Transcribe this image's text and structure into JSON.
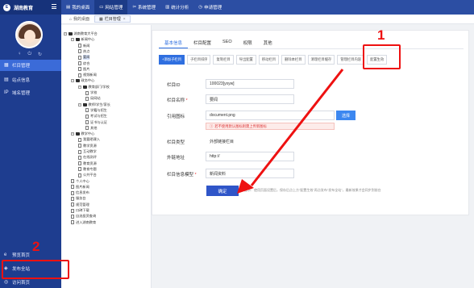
{
  "sidebar": {
    "logo_text": "湖南教育",
    "logo_mark": "E",
    "user_icons": [
      "♀",
      "⏻",
      "↻"
    ],
    "items": [
      {
        "label": "栏目管理",
        "icon": "▦",
        "active": true
      },
      {
        "label": "站点信息",
        "icon": "▤",
        "active": false
      },
      {
        "label": "域名管理",
        "icon": "IP",
        "active": false
      },
      {
        "label": "预览首页",
        "icon": "e",
        "active": false
      },
      {
        "label": "发布全站",
        "icon": "◈",
        "active": false
      },
      {
        "label": "访问首页",
        "icon": "◎",
        "active": false
      }
    ]
  },
  "topnav": [
    {
      "label": "我的桌面",
      "icon": "▤",
      "active": false
    },
    {
      "label": "网站管理",
      "icon": "▭",
      "active": true
    },
    {
      "label": "系统管理",
      "icon": "✂",
      "active": false
    },
    {
      "label": "统计分析",
      "icon": "▥",
      "active": false
    },
    {
      "label": "申请管理",
      "icon": "◷",
      "active": false
    }
  ],
  "page_tabs": [
    {
      "label": "我的桌面",
      "icon": "⌂"
    },
    {
      "label": "栏目管理",
      "icon": "▦",
      "closable": "×"
    }
  ],
  "tree": [
    {
      "label": "湖南教育大平台",
      "type": "folder",
      "lvl": 0,
      "toggle": "−"
    },
    {
      "label": "新闻中心",
      "type": "folder",
      "lvl": 1,
      "toggle": "−"
    },
    {
      "label": "新闻",
      "type": "doc",
      "lvl": 2
    },
    {
      "label": "热点",
      "type": "doc",
      "lvl": 2
    },
    {
      "label": "要闻",
      "type": "doc",
      "lvl": 2,
      "selected": true
    },
    {
      "label": "综合",
      "type": "doc",
      "lvl": 2
    },
    {
      "label": "图片",
      "type": "doc",
      "lvl": 2
    },
    {
      "label": "视频新闻",
      "type": "doc",
      "lvl": 2
    },
    {
      "label": "政务中心",
      "type": "folder",
      "lvl": 1,
      "toggle": "−"
    },
    {
      "label": "教育部门/学校",
      "type": "folder",
      "lvl": 2,
      "toggle": "−"
    },
    {
      "label": "学校",
      "type": "doc",
      "lvl": 3
    },
    {
      "label": "局网站",
      "type": "doc",
      "lvl": 3
    },
    {
      "label": "教师/学生/家长",
      "type": "folder",
      "lvl": 2,
      "toggle": "−"
    },
    {
      "label": "学籍与招生",
      "type": "doc",
      "lvl": 3
    },
    {
      "label": "考试与招生",
      "type": "doc",
      "lvl": 3
    },
    {
      "label": "证书与认证",
      "type": "doc",
      "lvl": 3
    },
    {
      "label": "其他",
      "type": "doc",
      "lvl": 3
    },
    {
      "label": "教学中心",
      "type": "folder",
      "lvl": 1,
      "toggle": "−"
    },
    {
      "label": "我要晒课入",
      "type": "doc",
      "lvl": 2
    },
    {
      "label": "教学资源",
      "type": "doc",
      "lvl": 2
    },
    {
      "label": "互动教学",
      "type": "doc",
      "lvl": 2
    },
    {
      "label": "在线测评",
      "type": "doc",
      "lvl": 2
    },
    {
      "label": "教育资源",
      "type": "doc",
      "lvl": 2
    },
    {
      "label": "教育专题",
      "type": "doc",
      "lvl": 2
    },
    {
      "label": "公共平台",
      "type": "doc",
      "lvl": 2
    },
    {
      "label": "个人中心",
      "type": "doc",
      "lvl": 1
    },
    {
      "label": "图片新闻",
      "type": "doc",
      "lvl": 1
    },
    {
      "label": "信息发布",
      "type": "doc",
      "lvl": 1
    },
    {
      "label": "服务台",
      "type": "doc",
      "lvl": 1
    },
    {
      "label": "规范管理",
      "type": "doc",
      "lvl": 1
    },
    {
      "label": "口碑下载",
      "type": "doc",
      "lvl": 1
    },
    {
      "label": "自选投资查询",
      "type": "doc",
      "lvl": 1
    },
    {
      "label": "进入湖南教育",
      "type": "doc",
      "lvl": 1
    }
  ],
  "main": {
    "tabs": [
      "基本信息",
      "栏目配置",
      "SEO",
      "权限",
      "其他"
    ],
    "active_tab": 0,
    "subtabs": [
      "+添加子栏目",
      "子栏目排序",
      "复制栏目",
      "导出配置",
      "移动栏目",
      "删除本栏目",
      "清理栏目缓存",
      "管理栏目内容",
      "配置生效"
    ],
    "fields": {
      "id_label": "栏目ID",
      "id_value": "100023[yxyw]",
      "name_label": "栏目名称",
      "name_required": "*",
      "name_value": "要闻",
      "icon_label": "引用图标",
      "icon_value": "document.png",
      "choose_label": "选择",
      "warn_text": "若不使用默认图标则需上传新图标",
      "type_label": "栏目类型",
      "type_value": "外部链接栏目",
      "url_label": "外链地址",
      "url_value": "http://",
      "tpl_label": "栏目信息模型",
      "tpl_required": "*",
      "tpl_value": "新闻资料"
    },
    "confirm_label": "确定",
    "hint_text": "提示：使用页面设置后，保存后点上方\"配置生效\"再点发布\"发布全站\"，最新效果才会同步到前台"
  },
  "annotations": {
    "num1": "1",
    "num2": "2",
    "color": "#e11111"
  }
}
